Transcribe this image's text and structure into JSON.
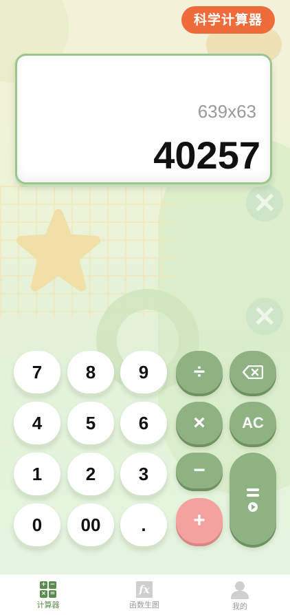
{
  "header": {
    "mode_label": "科学计算器"
  },
  "display": {
    "expression": "639x63",
    "result": "40257"
  },
  "keys": {
    "k7": "7",
    "k8": "8",
    "k9": "9",
    "divide": "÷",
    "k4": "4",
    "k5": "5",
    "k6": "6",
    "multiply": "×",
    "clear": "AC",
    "k1": "1",
    "k2": "2",
    "k3": "3",
    "minus": "−",
    "k0": "0",
    "k00": "00",
    "dot": ".",
    "plus": "+"
  },
  "nav": {
    "items": [
      {
        "label": "计算器",
        "icon": "calculator-icon",
        "active": true
      },
      {
        "label": "函数生图",
        "icon": "function-graph-icon",
        "active": false
      },
      {
        "label": "我的",
        "icon": "profile-icon",
        "active": false
      }
    ]
  },
  "colors": {
    "accent_orange": "#ee6c3c",
    "operator_green": "#8fb283",
    "plus_pink": "#f3a2a0",
    "nav_active": "#5a8a4c"
  }
}
